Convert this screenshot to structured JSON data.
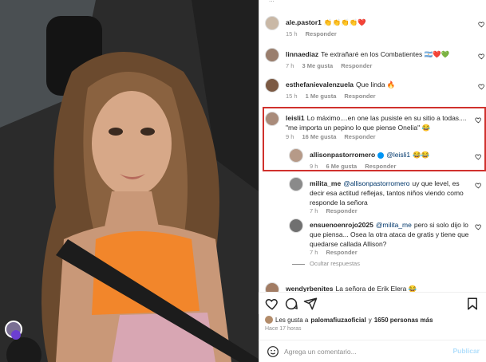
{
  "top_partial": "...",
  "comments": [
    {
      "user": "ale.pastor1",
      "text": "👏👏👏👏❤️",
      "time": "15 h",
      "likes": "",
      "reply": "Responder"
    },
    {
      "user": "linnaediaz",
      "text": "Te extrañaré en los Combatientes 🇦🇷❤️💚",
      "time": "7 h",
      "likes": "3 Me gusta",
      "reply": "Responder"
    },
    {
      "user": "esthefanievalenzuela",
      "text": "Que linda 🔥",
      "time": "15 h",
      "likes": "1 Me gusta",
      "reply": "Responder"
    },
    {
      "user": "leisli1",
      "text": "Lo máximo....en one las pusiste en su sitio a todas.... \"me importa un pepino lo que piense Onelia\" 😂",
      "time": "9 h",
      "likes": "16 Me gusta",
      "reply": "Responder"
    }
  ],
  "replies": [
    {
      "user": "allisonpastorromero",
      "mention": "@leisli1",
      "text": "😂😂",
      "time": "9 h",
      "likes": "6 Me gusta",
      "reply": "Responder"
    },
    {
      "user": "milita_me",
      "mention": "@allisonpastorromero",
      "text": "uy que level, es decir esa actitud reflejas, tantos niños viendo como responde la señora",
      "time": "7 h",
      "likes": "",
      "reply": "Responder"
    },
    {
      "user": "ensuenoenrojo2025",
      "mention": "@milita_me",
      "text": "pero si solo dijo lo que piensa... Osea la otra ataca de gratis y tiene que quedarse callada Allison?",
      "time": "7 h",
      "likes": "",
      "reply": "Responder"
    }
  ],
  "hide_replies": "Ocultar respuestas",
  "partial_comment": {
    "user": "wendyrbenites",
    "text": "La señora de Erik Elera 😂"
  },
  "likes_line": {
    "prefix": "Les gusta a",
    "user": "palomafiuzaoficial",
    "middle": "y",
    "count": "1650 personas más"
  },
  "time_ago": "Hace 17 horas",
  "composer": {
    "placeholder": "Agrega un comentario...",
    "post": "Publicar"
  }
}
